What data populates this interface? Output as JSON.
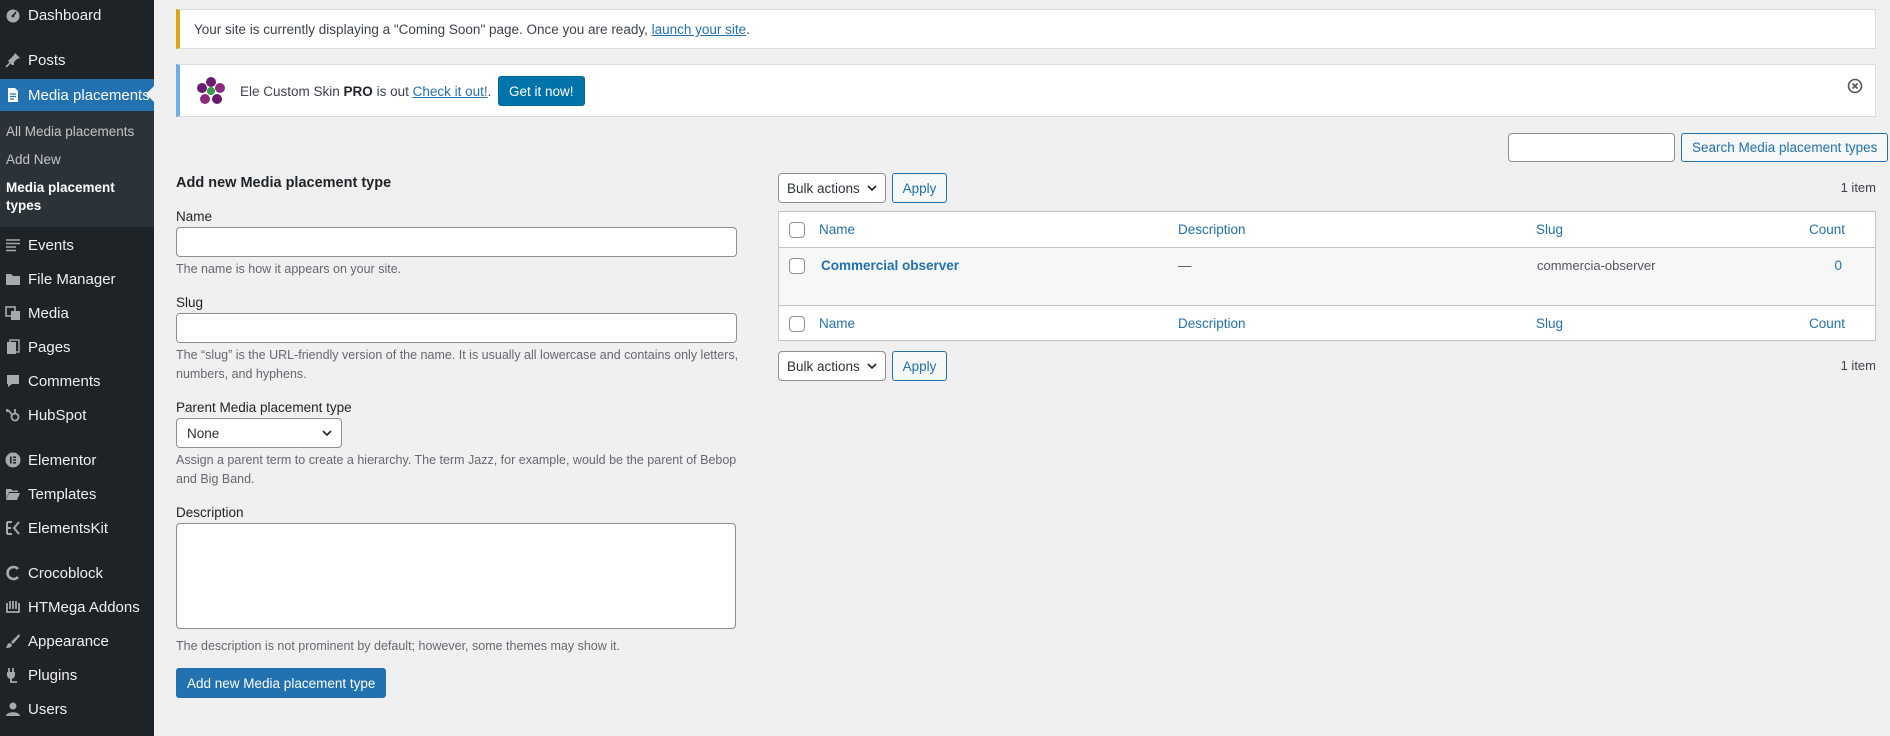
{
  "sidebar": {
    "dashboard": "Dashboard",
    "posts": "Posts",
    "media_placements": "Media placements",
    "submenu": {
      "all": "All Media placements",
      "add_new": "Add New",
      "types": "Media placement types"
    },
    "events": "Events",
    "file_manager": "File Manager",
    "media": "Media",
    "pages": "Pages",
    "comments": "Comments",
    "hubspot": "HubSpot",
    "elementor": "Elementor",
    "templates": "Templates",
    "elementskit": "ElementsKit",
    "crocoblock": "Crocoblock",
    "htmega": "HTMega Addons",
    "appearance": "Appearance",
    "plugins": "Plugins",
    "users": "Users"
  },
  "notices": {
    "coming_soon_text": "Your site is currently displaying a \"Coming Soon\" page. Once you are ready, ",
    "coming_soon_link": "launch your site",
    "coming_soon_end": ".",
    "ecs_text_1": "Ele Custom Skin ",
    "ecs_text_bold": "PRO",
    "ecs_text_2": " is out ",
    "ecs_link": "Check it out!",
    "ecs_end": ".",
    "ecs_button": "Get it now!"
  },
  "search": {
    "button": "Search Media placement types",
    "value": ""
  },
  "form": {
    "title": "Add new Media placement type",
    "name_label": "Name",
    "name_value": "",
    "name_help": "The name is how it appears on your site.",
    "slug_label": "Slug",
    "slug_value": "",
    "slug_help": "The “slug” is the URL-friendly version of the name. It is usually all lowercase and contains only letters, numbers, and hyphens.",
    "parent_label": "Parent Media placement type",
    "parent_value": "None",
    "parent_help": "Assign a parent term to create a hierarchy. The term Jazz, for example, would be the parent of Bebop and Big Band.",
    "description_label": "Description",
    "description_value": "",
    "description_help": "The description is not prominent by default; however, some themes may show it.",
    "submit": "Add new Media placement type"
  },
  "table": {
    "bulk_actions": "Bulk actions",
    "apply": "Apply",
    "item_count": "1 item",
    "columns": {
      "name": "Name",
      "description": "Description",
      "slug": "Slug",
      "count": "Count"
    },
    "rows": [
      {
        "name": "Commercial observer",
        "description": "—",
        "slug": "commercia-observer",
        "count": "0"
      }
    ]
  },
  "colors": {
    "sidebar_bg": "#1d2327",
    "accent": "#2271b1",
    "notice_warning": "#dba617",
    "notice_info": "#72aee6"
  }
}
